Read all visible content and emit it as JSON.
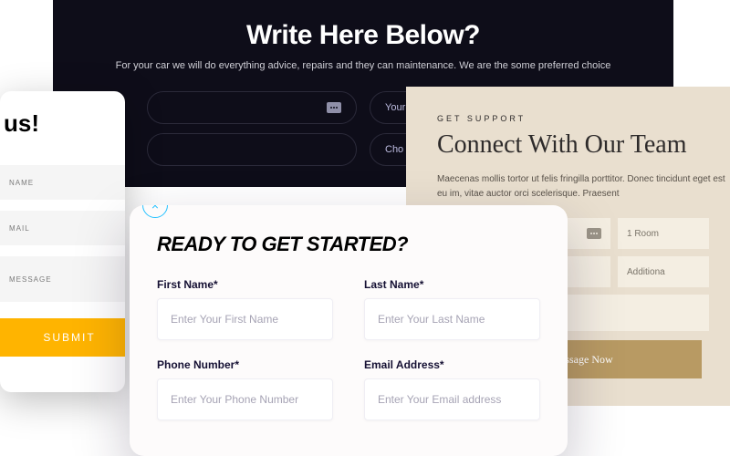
{
  "dark": {
    "title": "Write Here Below?",
    "sub": "For your car we will do everything advice, repairs and they can maintenance. We are the some preferred choice",
    "fields": {
      "name": "",
      "email": "Your",
      "subject": "",
      "choose": "Cho"
    }
  },
  "beige": {
    "eyebrow": "GET SUPPORT",
    "title": "Connect With Our Team",
    "lorem": "Maecenas mollis tortor ut felis fringilla porttitor. Donec tincidunt eget est eu im, vitae auctor orci scelerisque. Praesent",
    "room": "1 Room",
    "additional": "Additiona",
    "button": "Send Message Now"
  },
  "us": {
    "title": "us!",
    "name": "NAME",
    "email": "MAIL",
    "message": "MESSAGE",
    "submit": "SUBMIT"
  },
  "ready": {
    "title": "Ready to Get Started?",
    "fields": {
      "first": {
        "label": "First Name*",
        "ph": "Enter Your First Name"
      },
      "last": {
        "label": "Last Name*",
        "ph": "Enter Your Last Name"
      },
      "phone": {
        "label": "Phone Number*",
        "ph": "Enter Your Phone Number"
      },
      "email": {
        "label": "Email Address*",
        "ph": "Enter Your Email address"
      }
    }
  }
}
